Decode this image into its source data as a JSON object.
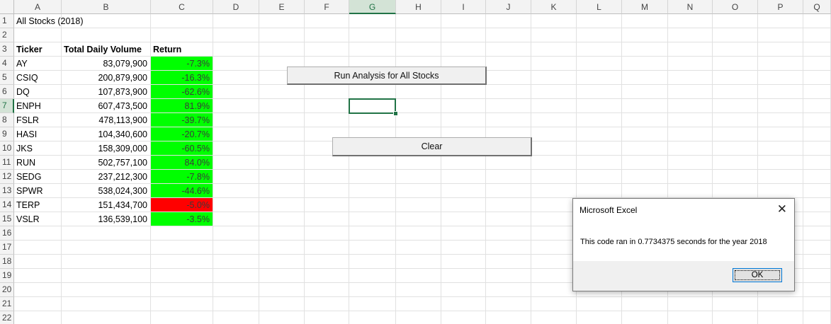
{
  "sheet": {
    "columns": [
      "A",
      "B",
      "C",
      "D",
      "E",
      "F",
      "G",
      "H",
      "I",
      "J",
      "K",
      "L",
      "M",
      "N",
      "O",
      "P",
      "Q"
    ],
    "rows": [
      "1",
      "2",
      "3",
      "4",
      "5",
      "6",
      "7",
      "8",
      "9",
      "10",
      "11",
      "12",
      "13",
      "14",
      "15",
      "16",
      "17",
      "18",
      "19",
      "20",
      "21",
      "22"
    ],
    "title": "All Stocks (2018)",
    "headers": {
      "ticker": "Ticker",
      "volume": "Total Daily Volume",
      "return": "Return"
    },
    "data": [
      {
        "ticker": "AY",
        "volume": "83,079,900",
        "return": "-7.3%",
        "status": "green"
      },
      {
        "ticker": "CSIQ",
        "volume": "200,879,900",
        "return": "-16.3%",
        "status": "green"
      },
      {
        "ticker": "DQ",
        "volume": "107,873,900",
        "return": "-62.6%",
        "status": "green"
      },
      {
        "ticker": "ENPH",
        "volume": "607,473,500",
        "return": "81.9%",
        "status": "green"
      },
      {
        "ticker": "FSLR",
        "volume": "478,113,900",
        "return": "-39.7%",
        "status": "green"
      },
      {
        "ticker": "HASI",
        "volume": "104,340,600",
        "return": "-20.7%",
        "status": "green"
      },
      {
        "ticker": "JKS",
        "volume": "158,309,000",
        "return": "-60.5%",
        "status": "green"
      },
      {
        "ticker": "RUN",
        "volume": "502,757,100",
        "return": "84.0%",
        "status": "green"
      },
      {
        "ticker": "SEDG",
        "volume": "237,212,300",
        "return": "-7.8%",
        "status": "green"
      },
      {
        "ticker": "SPWR",
        "volume": "538,024,300",
        "return": "-44.6%",
        "status": "green"
      },
      {
        "ticker": "TERP",
        "volume": "151,434,700",
        "return": "-5.0%",
        "status": "red"
      },
      {
        "ticker": "VSLR",
        "volume": "136,539,100",
        "return": "-3.5%",
        "status": "green"
      }
    ],
    "selected_column": "G",
    "selected_row": "7"
  },
  "buttons": {
    "run": "Run Analysis for All Stocks",
    "clear": "Clear"
  },
  "dialog": {
    "title": "Microsoft Excel",
    "close_icon": "close-icon",
    "message": "This code ran in 0.7734375 seconds for the year 2018",
    "ok": "OK"
  },
  "colors": {
    "positive_fill": "#00ff00",
    "negative_fill": "#ff0000",
    "excel_green": "#217346"
  }
}
